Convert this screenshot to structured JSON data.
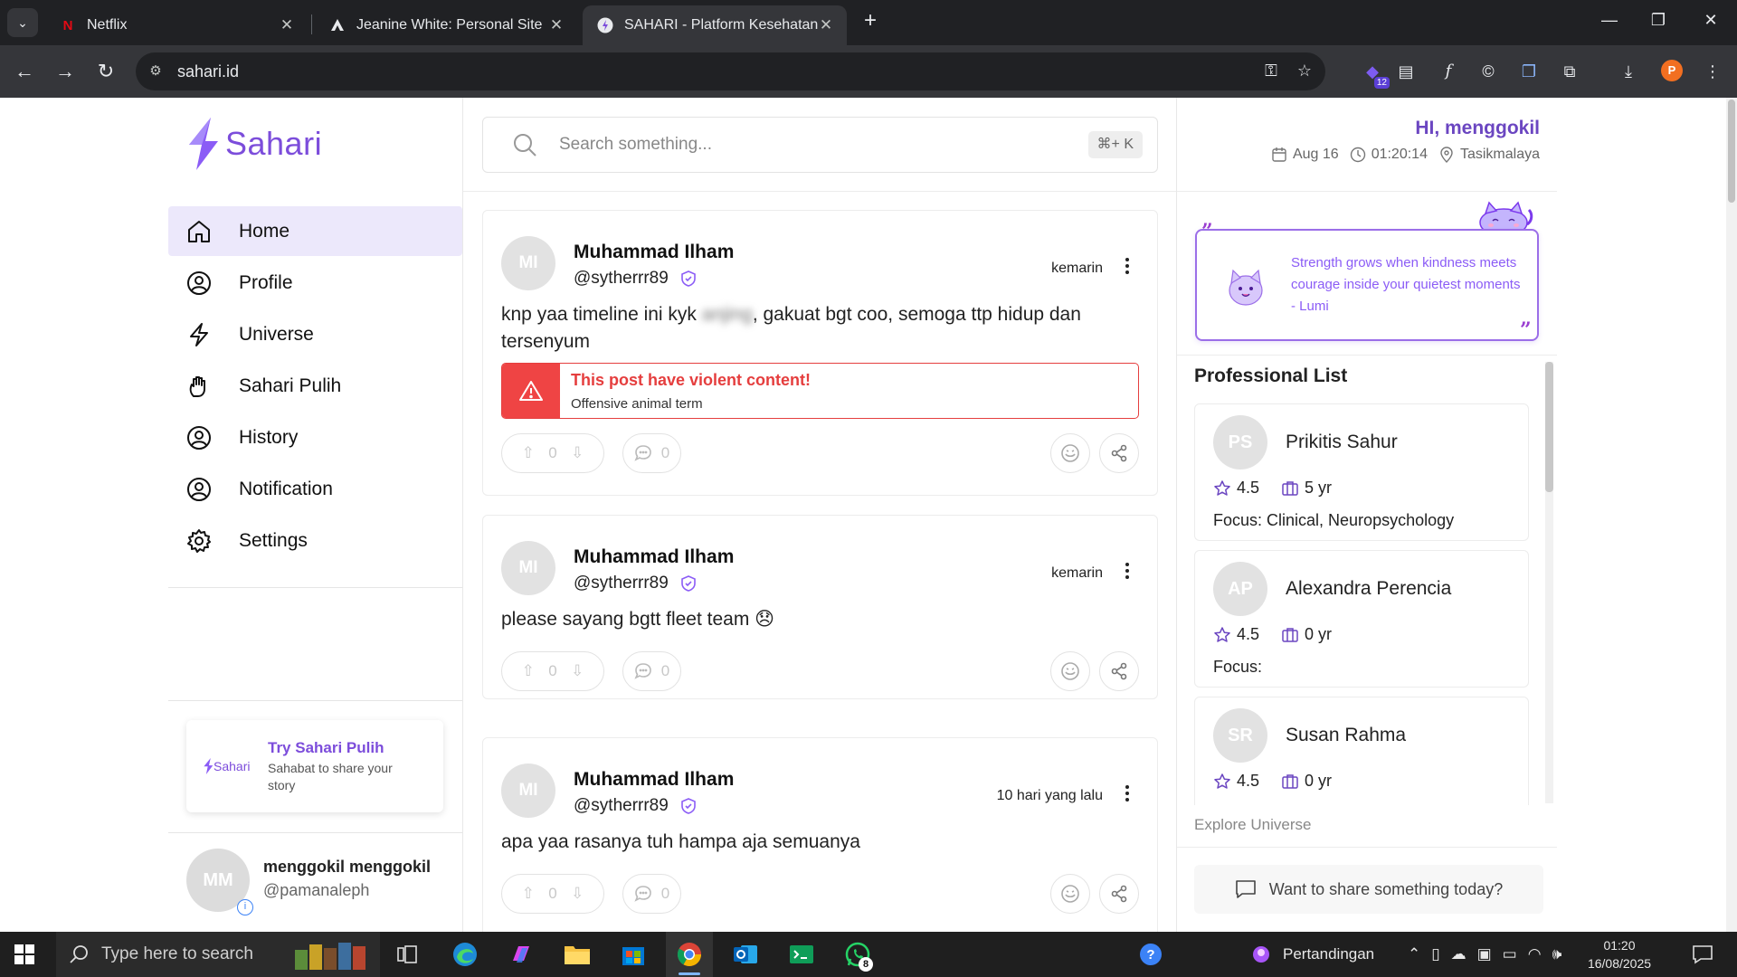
{
  "browser": {
    "tabs": [
      {
        "title": "Netflix",
        "icon": "netflix-icon",
        "active": false
      },
      {
        "title": "Jeanine White: Personal Site",
        "icon": "site-icon",
        "active": false
      },
      {
        "title": "SAHARI - Platform Kesehatan M",
        "icon": "sahari-icon",
        "active": true
      }
    ],
    "url": "sahari.id",
    "extension_badge": "12",
    "profile_initial": "P"
  },
  "sidebar": {
    "logo_text": "Sahari",
    "nav": [
      {
        "label": "Home",
        "icon": "home-icon",
        "active": true
      },
      {
        "label": "Profile",
        "icon": "user-circle-icon",
        "active": false
      },
      {
        "label": "Universe",
        "icon": "bolt-icon",
        "active": false
      },
      {
        "label": "Sahari Pulih",
        "icon": "hand-icon",
        "active": false
      },
      {
        "label": "History",
        "icon": "user-circle-icon",
        "active": false
      },
      {
        "label": "Notification",
        "icon": "user-circle-icon",
        "active": false
      },
      {
        "label": "Settings",
        "icon": "gear-icon",
        "active": false
      }
    ],
    "promo": {
      "logo_text": "Sahari",
      "title": "Try Sahari Pulih",
      "subtitle": "Sahabat to share your story"
    },
    "user": {
      "initials": "MM",
      "name": "menggokil menggokil",
      "handle": "@pamanaleph"
    }
  },
  "search": {
    "placeholder": "Search something...",
    "shortcut": "⌘+ K"
  },
  "posts": [
    {
      "initials": "MI",
      "name": "Muhammad Ilham",
      "handle": "@sytherrr89",
      "time": "kemarin",
      "text_before": "knp yaa timeline ini kyk ",
      "text_blurred": "anjing",
      "text_after": ", gakuat bgt coo, semoga ttp hidup dan tersenyum",
      "warning": {
        "title": "This post have violent content!",
        "subtitle": "Offensive animal term"
      },
      "upvotes": "0",
      "comments": "0"
    },
    {
      "initials": "MI",
      "name": "Muhammad Ilham",
      "handle": "@sytherrr89",
      "time": "kemarin",
      "text": "please sayang bgtt fleet team 😞",
      "upvotes": "0",
      "comments": "0"
    },
    {
      "initials": "MI",
      "name": "Muhammad Ilham",
      "handle": "@sytherrr89",
      "time": "10 hari yang lalu",
      "text": "apa yaa rasanya tuh hampa aja semuanya",
      "upvotes": "0",
      "comments": "0"
    }
  ],
  "right": {
    "greeting": "HI, menggokil",
    "date": "Aug 16",
    "time": "01:20:14",
    "location": "Tasikmalaya",
    "quote": "Strength grows when kindness meets courage inside your quietest moments - Lumi",
    "professional_title": "Professional List",
    "professionals": [
      {
        "initials": "PS",
        "name": "Prikitis Sahur",
        "rating": "4.5",
        "years": "5 yr",
        "focus": "Focus: Clinical, Neuropsychology"
      },
      {
        "initials": "AP",
        "name": "Alexandra Perencia",
        "rating": "4.5",
        "years": "0 yr",
        "focus": "Focus:"
      },
      {
        "initials": "SR",
        "name": "Susan Rahma",
        "rating": "4.5",
        "years": "0 yr",
        "focus": ""
      }
    ],
    "explore": "Explore Universe",
    "share_prompt": "Want to share something today?"
  },
  "taskbar": {
    "search_placeholder": "Type here to search",
    "whatsapp_badge": "8",
    "weather_text": "Pertandingan",
    "clock_time": "01:20",
    "clock_date": "16/08/2025"
  },
  "colors": {
    "brand": "#7c4ddb",
    "danger": "#ef4444",
    "nav_active_bg": "#ece8fb"
  }
}
